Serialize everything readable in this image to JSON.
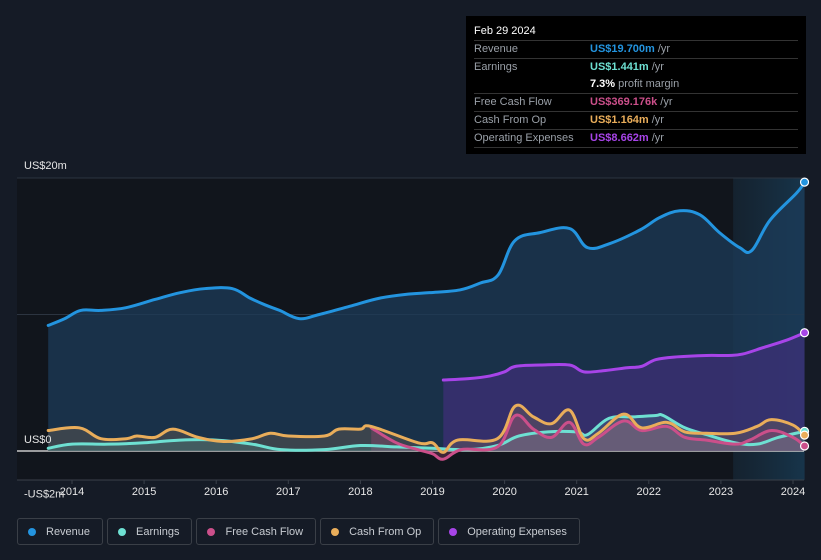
{
  "tooltip": {
    "date": "Feb 29 2024",
    "rows": [
      {
        "label": "Revenue",
        "value": "US$19.700m",
        "unit": "/yr",
        "color": "#2394df"
      },
      {
        "label": "Earnings",
        "value": "US$1.441m",
        "unit": "/yr",
        "color": "#6ee0d2"
      },
      {
        "label": "",
        "value": "7.3%",
        "unit": "profit margin",
        "color": "#ffffff"
      },
      {
        "label": "Free Cash Flow",
        "value": "US$369.176k",
        "unit": "/yr",
        "color": "#cb4f8a"
      },
      {
        "label": "Cash From Op",
        "value": "US$1.164m",
        "unit": "/yr",
        "color": "#e9ad5a"
      },
      {
        "label": "Operating Expenses",
        "value": "US$8.662m",
        "unit": "/yr",
        "color": "#a744e8"
      }
    ]
  },
  "legend": [
    {
      "label": "Revenue",
      "color": "#2394df"
    },
    {
      "label": "Earnings",
      "color": "#6ee0d2"
    },
    {
      "label": "Free Cash Flow",
      "color": "#cb4f8a"
    },
    {
      "label": "Cash From Op",
      "color": "#e9ad5a"
    },
    {
      "label": "Operating Expenses",
      "color": "#a744e8"
    }
  ],
  "chart_data": {
    "type": "area",
    "title": "",
    "xlabel": "",
    "ylabel": "",
    "ylim": [
      -2,
      20
    ],
    "xlim": [
      2013.33,
      2024.2
    ],
    "y_tick_labels": [
      {
        "value": 20,
        "label": "US$20m"
      },
      {
        "value": 0,
        "label": "US$0"
      },
      {
        "value": -2,
        "label": "-US$2m"
      }
    ],
    "gridlines_y": [
      20,
      10,
      0
    ],
    "x_ticks": [
      2014,
      2015,
      2016,
      2017,
      2018,
      2019,
      2020,
      2021,
      2022,
      2023,
      2024
    ],
    "x_tick_labels": [
      "2014",
      "2015",
      "2016",
      "2017",
      "2018",
      "2019",
      "2020",
      "2021",
      "2022",
      "2023",
      "2024"
    ],
    "highlight_range": [
      2023.17,
      2024.16
    ],
    "legend_position": "bottom",
    "series": [
      {
        "name": "Revenue",
        "color": "#2394df",
        "unit": "US$m",
        "x": [
          2013.67,
          2013.9,
          2014.12,
          2014.4,
          2014.75,
          2015.15,
          2015.5,
          2015.85,
          2016.22,
          2016.47,
          2016.68,
          2016.88,
          2017.15,
          2017.43,
          2017.85,
          2018.27,
          2018.68,
          2018.96,
          2019.38,
          2019.66,
          2019.91,
          2020.14,
          2020.49,
          2020.9,
          2021.15,
          2021.46,
          2021.88,
          2022.15,
          2022.43,
          2022.71,
          2022.98,
          2023.26,
          2023.43,
          2023.68,
          2024.05,
          2024.16
        ],
        "values": [
          9.2,
          9.7,
          10.3,
          10.3,
          10.5,
          11.1,
          11.6,
          11.9,
          11.9,
          11.2,
          10.7,
          10.3,
          9.7,
          10.0,
          10.6,
          11.2,
          11.5,
          11.6,
          11.8,
          12.3,
          12.9,
          15.4,
          16.0,
          16.3,
          14.9,
          15.2,
          16.2,
          17.1,
          17.6,
          17.3,
          16.0,
          14.9,
          14.7,
          16.9,
          18.9,
          19.7
        ]
      },
      {
        "name": "Earnings",
        "color": "#6ee0d2",
        "unit": "US$m",
        "x": [
          2013.67,
          2014.0,
          2014.5,
          2015.0,
          2015.5,
          2016.0,
          2016.5,
          2016.9,
          2017.5,
          2018.0,
          2018.5,
          2019.0,
          2019.5,
          2019.9,
          2020.2,
          2020.6,
          2021.0,
          2021.15,
          2021.45,
          2021.8,
          2022.1,
          2022.2,
          2022.5,
          2022.8,
          2023.2,
          2023.5,
          2023.8,
          2024.16
        ],
        "values": [
          0.2,
          0.5,
          0.5,
          0.6,
          0.8,
          0.8,
          0.5,
          0.1,
          0.1,
          0.4,
          0.3,
          0.2,
          0.1,
          0.4,
          1.1,
          1.4,
          1.4,
          1.2,
          2.4,
          2.5,
          2.6,
          2.6,
          1.7,
          1.2,
          0.6,
          0.5,
          1.0,
          1.441
        ]
      },
      {
        "name": "Free Cash Flow",
        "color": "#cb4f8a",
        "unit": "US$m",
        "x": [
          2018.15,
          2018.5,
          2018.8,
          2019.0,
          2019.15,
          2019.4,
          2019.9,
          2020.15,
          2020.4,
          2020.65,
          2020.9,
          2021.1,
          2021.3,
          2021.65,
          2021.9,
          2022.25,
          2022.5,
          2022.8,
          2023.2,
          2023.4,
          2023.7,
          2024.0,
          2024.16
        ],
        "values": [
          1.7,
          0.6,
          0.1,
          -0.2,
          -0.6,
          0.1,
          0.3,
          2.6,
          1.6,
          1.0,
          2.1,
          0.5,
          1.0,
          2.2,
          1.5,
          1.8,
          1.0,
          0.8,
          0.5,
          0.8,
          1.5,
          1.0,
          0.369
        ]
      },
      {
        "name": "Cash From Op",
        "color": "#e9ad5a",
        "unit": "US$m",
        "x": [
          2013.67,
          2014.1,
          2014.4,
          2014.75,
          2014.9,
          2015.15,
          2015.4,
          2015.75,
          2016.1,
          2016.5,
          2016.75,
          2017.0,
          2017.5,
          2017.7,
          2018.0,
          2018.15,
          2018.8,
          2019.0,
          2019.15,
          2019.35,
          2019.9,
          2020.15,
          2020.4,
          2020.65,
          2020.9,
          2021.1,
          2021.3,
          2021.65,
          2021.9,
          2022.25,
          2022.5,
          2022.8,
          2023.2,
          2023.5,
          2023.7,
          2024.0,
          2024.16
        ],
        "values": [
          1.5,
          1.7,
          0.9,
          0.9,
          1.1,
          1.0,
          1.6,
          1.0,
          0.7,
          0.9,
          1.3,
          1.1,
          1.1,
          1.6,
          1.6,
          1.8,
          0.6,
          0.6,
          -0.1,
          0.8,
          0.9,
          3.3,
          2.5,
          2.0,
          3.0,
          0.9,
          1.3,
          2.7,
          1.7,
          2.1,
          1.4,
          1.3,
          1.3,
          1.8,
          2.3,
          1.9,
          1.164
        ]
      },
      {
        "name": "Operating Expenses",
        "color": "#a744e8",
        "unit": "US$m",
        "x": [
          2019.15,
          2019.5,
          2019.8,
          2020.0,
          2020.15,
          2020.5,
          2020.9,
          2021.1,
          2021.4,
          2021.7,
          2021.9,
          2022.1,
          2022.4,
          2022.8,
          2023.1,
          2023.3,
          2023.6,
          2023.9,
          2024.16
        ],
        "values": [
          5.2,
          5.3,
          5.5,
          5.8,
          6.2,
          6.3,
          6.3,
          5.8,
          5.9,
          6.1,
          6.2,
          6.7,
          6.9,
          7.0,
          7.0,
          7.1,
          7.6,
          8.1,
          8.662
        ]
      }
    ]
  }
}
